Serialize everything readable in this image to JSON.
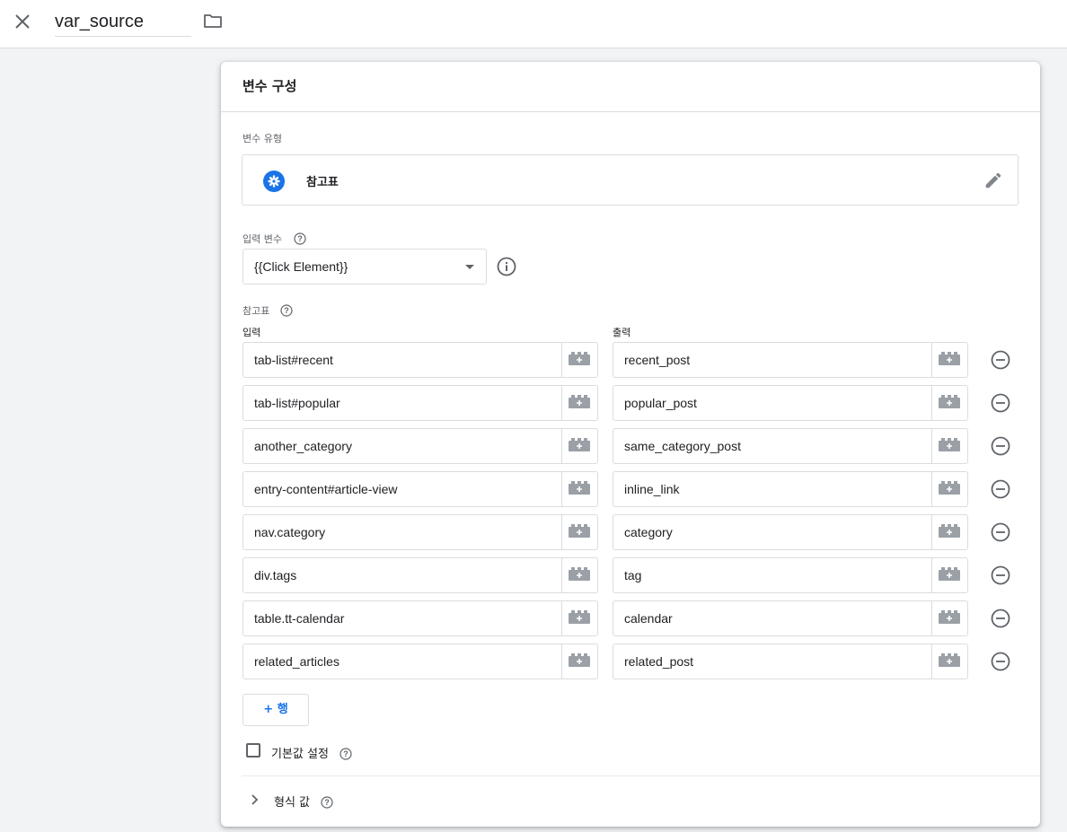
{
  "header": {
    "variable_name": "var_source",
    "close_icon": "close-icon",
    "folder_icon": "folder-icon"
  },
  "card": {
    "title": "변수 구성",
    "variable_type_label": "변수 유형",
    "variable_type": {
      "name": "참고표",
      "icon": "gear-icon"
    },
    "input_variable_label": "입력 변수",
    "input_variable_value": "{{Click Element}}",
    "lookup_table_label": "참고표",
    "input_col_label": "입력",
    "output_col_label": "출력",
    "rows": [
      {
        "input": "tab-list#recent",
        "output": "recent_post"
      },
      {
        "input": "tab-list#popular",
        "output": "popular_post"
      },
      {
        "input": "another_category",
        "output": "same_category_post"
      },
      {
        "input": "entry-content#article-view",
        "output": "inline_link"
      },
      {
        "input": "nav.category",
        "output": "category"
      },
      {
        "input": "div.tags",
        "output": "tag"
      },
      {
        "input": "table.tt-calendar",
        "output": "calendar"
      },
      {
        "input": "related_articles",
        "output": "related_post"
      }
    ],
    "add_row_label": "+ 행",
    "default_value_label": "기본값 설정",
    "default_value_checked": false,
    "format_value_label": "형식 값"
  },
  "colors": {
    "accent": "#1a73e8",
    "icon_gray": "#5f6368",
    "border": "#dadce0"
  }
}
